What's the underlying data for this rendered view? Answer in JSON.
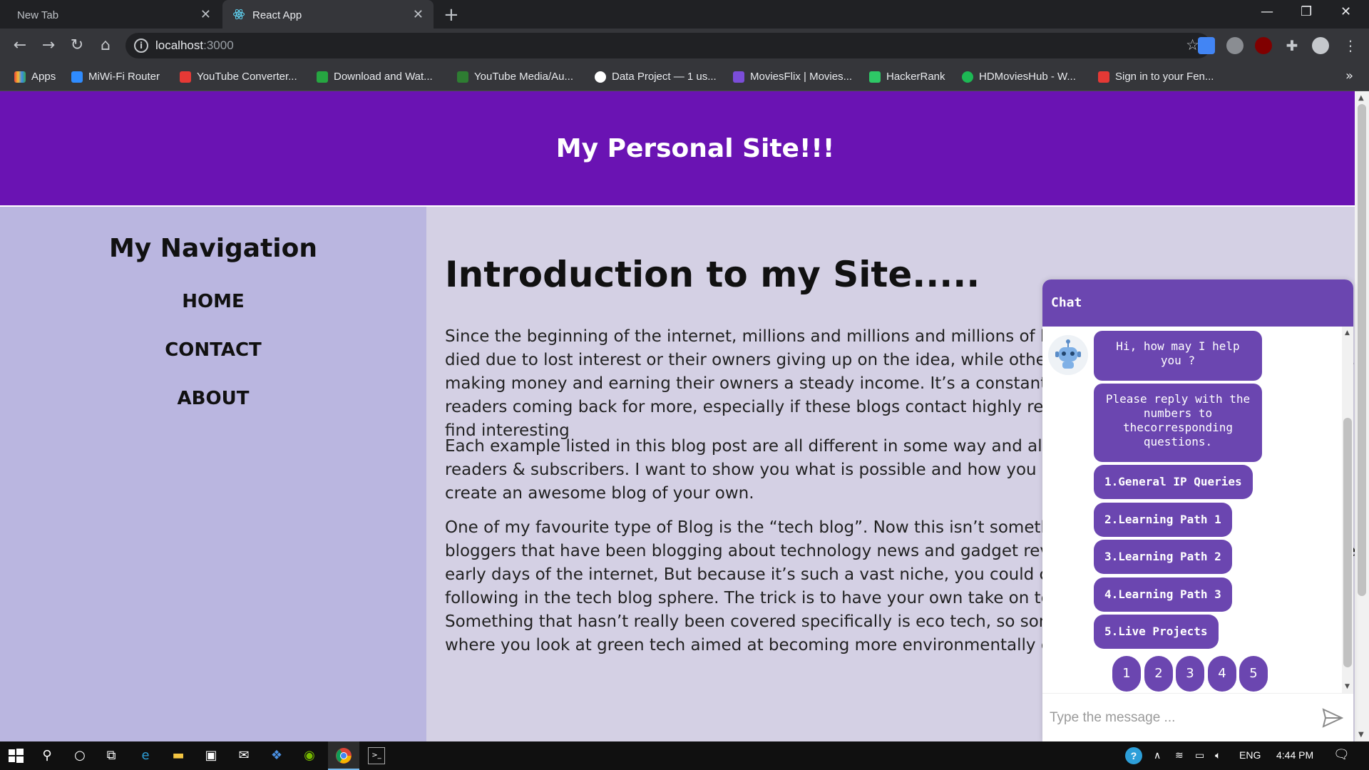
{
  "browser": {
    "tabs": [
      {
        "title": "New Tab"
      },
      {
        "title": "React App"
      }
    ],
    "url_host": "localhost",
    "url_port": ":3000",
    "bookmarks": [
      {
        "label": "Apps",
        "color": "#e8453c"
      },
      {
        "label": "MiWi-Fi Router",
        "color": "#2f8cff"
      },
      {
        "label": "YouTube Converter...",
        "color": "#e53935"
      },
      {
        "label": "Download and Wat...",
        "color": "#26a641"
      },
      {
        "label": "YouTube Media/Au...",
        "color": "#2e7d32"
      },
      {
        "label": "Data Project — 1 us...",
        "color": "#ffffff"
      },
      {
        "label": "MoviesFlix | Movies...",
        "color": "#7b4dd8"
      },
      {
        "label": "HackerRank",
        "color": "#2ec866"
      },
      {
        "label": "HDMoviesHub - W...",
        "color": "#1db954"
      },
      {
        "label": "Sign in to your Fen...",
        "color": "#e53935"
      }
    ]
  },
  "site": {
    "title": "My Personal Site!!!",
    "nav_heading": "My Navigation",
    "nav_links": [
      "HOME",
      "CONTACT",
      "ABOUT"
    ],
    "main_heading": "Introduction to my Site.....",
    "paragraphs": [
      "Since the beginning of the internet, millions and millions and millions of blogs have been created. Many have died due to lost interest or their owners giving up on the idea, while others have thrived and continue to grow, making money and earning their owners a steady income. It’s a constant evolution of content that keeps readers coming back for more, especially if these blogs contact highly resourceful material that the readers find interesting",
      "Each example listed in this blog post are all different in some way and all bring something unique to their readers & subscribers. I want to show you what is possible and how you can take inspiration from them and create an awesome blog of your own.",
      "One of my favourite type of Blog is the “tech blog”. Now this isn’t something new, and there are many bloggers that have been blogging about technology news and gadget reviews in detail on their blogs since the early days of the internet, But because it’s such a vast niche, you could carve out yourself a really good following in the tech blog sphere. The trick is to have your own take on tech and don’t just follow the trends. Something that hasn’t really been covered specifically is eco tech, so something to think about. Maybe a blog where you look at green tech aimed at becoming more environmentally conscious."
    ]
  },
  "chat": {
    "title": "Chat",
    "bot_messages": [
      "Hi, how may I help you ?",
      "Please reply with the numbers to thecorresponding questions."
    ],
    "options": [
      "1.General IP Queries",
      "2.Learning Path 1",
      "3.Learning Path 2",
      "4.Learning Path 3",
      "5.Live Projects"
    ],
    "quick_replies": [
      "1",
      "2",
      "3",
      "4",
      "5"
    ],
    "input_placeholder": "Type the message ...",
    "accent_color": "#6b46b0"
  },
  "taskbar": {
    "language": "ENG",
    "time": "4:44 PM"
  }
}
